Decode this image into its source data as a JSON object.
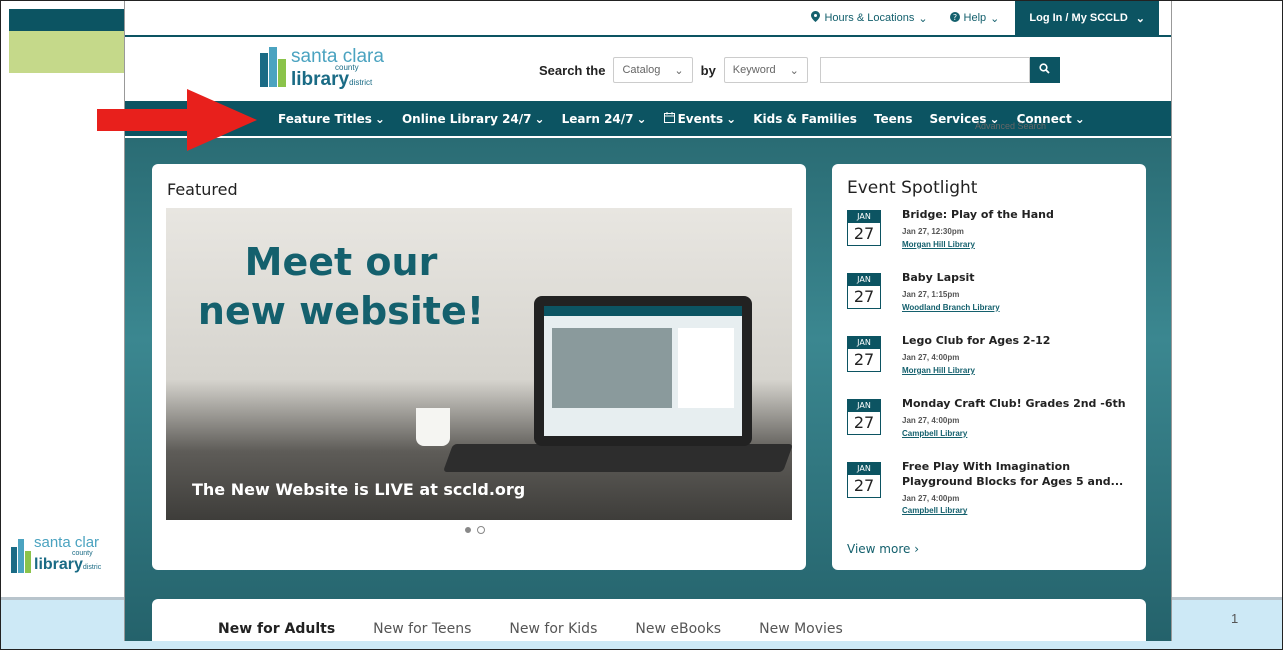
{
  "slide": {
    "number": "1",
    "logo": {
      "line1": "santa clar",
      "line2": "county",
      "line3": "library",
      "line3_small": "distric"
    }
  },
  "utility": {
    "hours": "Hours & Locations",
    "help": "Help",
    "login": "Log In / My SCCLD"
  },
  "logo": {
    "line1": "santa clara",
    "line2": "county",
    "line3": "library",
    "line3_small": "district"
  },
  "search": {
    "label": "Search the",
    "scope": "Catalog",
    "by_label": "by",
    "field": "Keyword",
    "placeholder": "",
    "advanced": "Advanced Search"
  },
  "nav": {
    "items": [
      {
        "label": "Feature Titles",
        "caret": true
      },
      {
        "label": "Online Library 24/7",
        "caret": true
      },
      {
        "label": "Learn 24/7",
        "caret": true
      },
      {
        "label": "Events",
        "caret": true,
        "icon": "calendar-icon"
      },
      {
        "label": "Kids & Families",
        "caret": false
      },
      {
        "label": "Teens",
        "caret": false
      },
      {
        "label": "Services",
        "caret": true
      },
      {
        "label": "Connect",
        "caret": true
      }
    ]
  },
  "featured": {
    "heading": "Featured",
    "hero_title_1": "Meet our",
    "hero_title_2": "new website!",
    "caption": "The New Website is LIVE at sccld.org",
    "active_slide": 1,
    "slide_count": 2
  },
  "spotlight": {
    "heading": "Event Spotlight",
    "events": [
      {
        "month": "JAN",
        "day": "27",
        "title": "Bridge: Play of the Hand",
        "date": "Jan 27, 12:30pm",
        "location": "Morgan Hill Library"
      },
      {
        "month": "JAN",
        "day": "27",
        "title": "Baby Lapsit",
        "date": "Jan 27, 1:15pm",
        "location": "Woodland Branch Library"
      },
      {
        "month": "JAN",
        "day": "27",
        "title": "Lego Club for Ages 2-12",
        "date": "Jan 27, 4:00pm",
        "location": "Morgan Hill Library"
      },
      {
        "month": "JAN",
        "day": "27",
        "title": "Monday Craft Club! Grades 2nd -6th",
        "date": "Jan 27, 4:00pm",
        "location": "Campbell Library"
      },
      {
        "month": "JAN",
        "day": "27",
        "title": "Free Play With Imagination Playground Blocks for Ages 5 and...",
        "date": "Jan 27, 4:00pm",
        "location": "Campbell Library"
      }
    ],
    "view_more": "View more ›"
  },
  "tabs": [
    "New for Adults",
    "New for Teens",
    "New for Kids",
    "New eBooks",
    "New Movies"
  ],
  "colors": {
    "brand": "#0c5462",
    "accent_green": "#c5d98a",
    "arrow": "#e8201c"
  }
}
